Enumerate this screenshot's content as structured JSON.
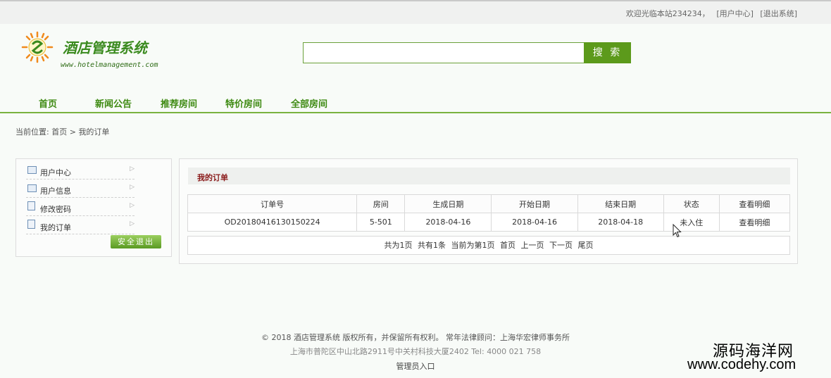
{
  "topbar": {
    "welcome": "欢迎光临本站234234，",
    "user_center": "[用户中心]",
    "logout": "[退出系统]"
  },
  "logo": {
    "title": "酒店管理系统",
    "url": "www.hotelmanagement.com",
    "icon": "sun-logo-icon"
  },
  "search": {
    "placeholder": "",
    "button": "搜 索"
  },
  "nav": [
    "首页",
    "新闻公告",
    "推荐房间",
    "特价房间",
    "全部房间"
  ],
  "breadcrumb": {
    "prefix": "当前位置:",
    "home": "首页",
    "sep": ">",
    "current": "我的订单"
  },
  "sidebar": {
    "items": [
      {
        "label": "用户中心",
        "icon": "id-card-icon"
      },
      {
        "label": "用户信息",
        "icon": "id-card-icon"
      },
      {
        "label": "修改密码",
        "icon": "document-icon"
      },
      {
        "label": "我的订单",
        "icon": "document-icon"
      }
    ],
    "logout_button": "安全退出"
  },
  "orders": {
    "title": "我的订单",
    "columns": [
      "订单号",
      "房间",
      "生成日期",
      "开始日期",
      "结束日期",
      "状态",
      "查看明细"
    ],
    "rows": [
      [
        "OD20180416130150224",
        "5-501",
        "2018-04-16",
        "2018-04-16",
        "2018-04-18",
        "未入住",
        "查看明细"
      ]
    ],
    "pager": {
      "total_pages": "共为1页",
      "total_items": "共有1条",
      "current": "当前为第1页",
      "first": "首页",
      "prev": "上一页",
      "next": "下一页",
      "last": "尾页"
    }
  },
  "footer": {
    "copyright": "© 2018 酒店管理系统 版权所有，并保留所有权利。 常年法律顾问：上海华宏律师事务所",
    "address": "上海市普陀区中山北路2911号中关村科技大厦2402 Tel: 4000 021 758",
    "admin_link": "管理员入口"
  },
  "watermark": {
    "cn": "源码海洋网",
    "url": "www.codehy.com"
  },
  "colors": {
    "accent": "#5c9a1b",
    "nav_text": "#3e8a12",
    "title_red": "#8a1a1a"
  }
}
